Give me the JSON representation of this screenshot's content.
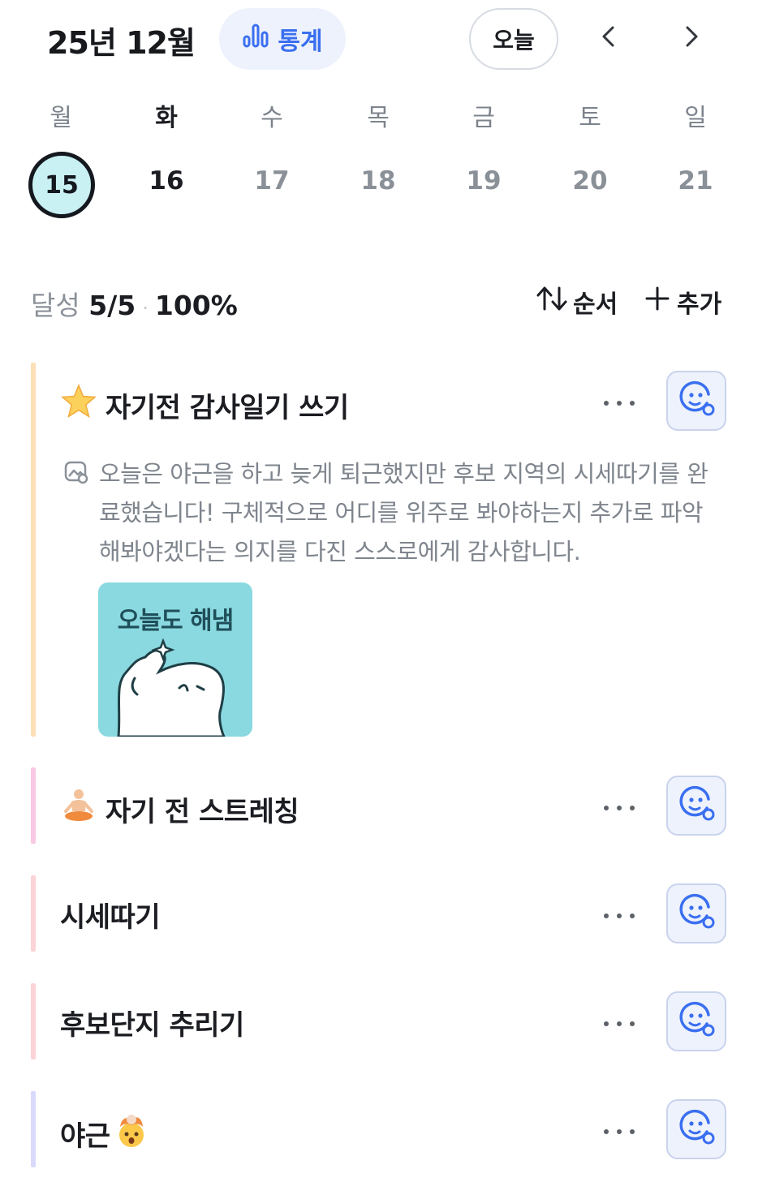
{
  "header": {
    "month_title": "25년 12월",
    "stats_label": "통계",
    "today_label": "오늘",
    "prev_icon": "chevron-left-icon",
    "next_icon": "chevron-right-icon"
  },
  "week": {
    "weekdays": [
      "월",
      "화",
      "수",
      "목",
      "금",
      "토",
      "일"
    ],
    "dates": [
      "15",
      "16",
      "17",
      "18",
      "19",
      "20",
      "21"
    ],
    "selected_index": 0
  },
  "summary": {
    "label": "달성",
    "count": "5/5",
    "percent": "100%",
    "sort_label": "순서",
    "add_label": "추가"
  },
  "habits": [
    {
      "emoji": "🌟",
      "title": "자기전 감사일기 쓰기",
      "bar_color": "#fde0b7",
      "memo": "오늘은 야근을 하고 늦게 퇴근했지만 후보 지역의 시세따기를 완료했습니다! 구체적으로 어디를 위주로 봐야하는지 추가로 파악해봐야겠다는 의지를 다진 스스로에게 감사합니다.",
      "sticker_text": "오늘도 해냄"
    },
    {
      "emoji": "🧘",
      "title": "자기 전 스트레칭",
      "bar_color": "#f9c8e4"
    },
    {
      "emoji": "",
      "title": "시세따기",
      "bar_color": "#fcd3d6"
    },
    {
      "emoji": "",
      "title": "후보단지 추리기",
      "bar_color": "#fcd3d6"
    },
    {
      "emoji": "🤯",
      "title": "야근",
      "bar_color": "#d9dafb"
    }
  ],
  "colors": {
    "accent": "#3a6ff0",
    "today_fill": "#c9f0f2",
    "sticker_bg": "#8ad9e0"
  }
}
